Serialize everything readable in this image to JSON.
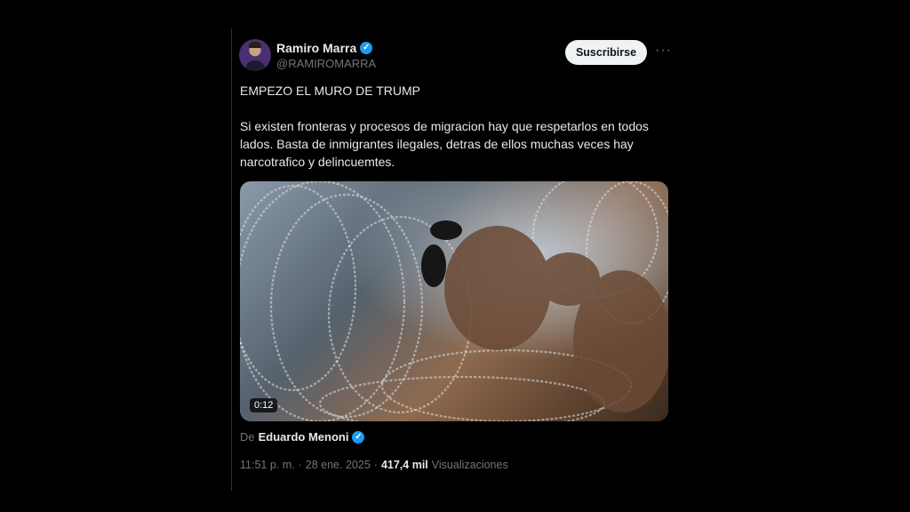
{
  "author": {
    "name": "Ramiro Marra",
    "handle": "@RAMIROMARRA"
  },
  "actions": {
    "subscribe_label": "Suscribirse",
    "more_label": "···"
  },
  "post": {
    "line1": "EMPEZO EL MURO DE TRUMP",
    "paragraph": "Si existen fronteras y procesos de migracion hay que respetarlos en todos lados. Basta de inmigrantes ilegales, detras de ellos muchas veces hay narcotrafico y delincuemtes."
  },
  "media": {
    "duration": "0:12"
  },
  "source": {
    "prefix": "De",
    "author": "Eduardo Menoni"
  },
  "meta": {
    "time": "11:51 p. m.",
    "separator": "·",
    "date": "28 ene. 2025",
    "views_count": "417,4 mil",
    "views_label": "Visualizaciones"
  },
  "colors": {
    "background": "#000000",
    "verified": "#1d9bf0",
    "muted": "#71767b",
    "text": "#e7e9ea"
  },
  "icons": [
    "verified-badge-icon",
    "more-options-icon"
  ]
}
